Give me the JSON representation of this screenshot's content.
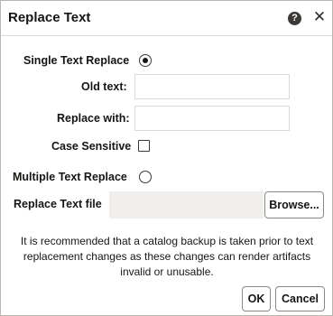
{
  "dialog": {
    "title": "Replace Text",
    "help_symbol": "?",
    "close_symbol": "✕"
  },
  "form": {
    "single_replace_label": "Single Text Replace",
    "single_replace_selected": true,
    "old_text_label": "Old text:",
    "old_text_value": "",
    "replace_with_label": "Replace with:",
    "replace_with_value": "",
    "case_sensitive_label": "Case Sensitive",
    "case_sensitive_checked": false,
    "multiple_replace_label": "Multiple Text Replace",
    "multiple_replace_selected": false,
    "replace_file_label": "Replace Text file",
    "browse_label": "Browse..."
  },
  "notice": "It is recommended that a catalog backup is taken prior to text replacement changes as these changes can render artifacts invalid or unusable.",
  "footer": {
    "ok_label": "OK",
    "cancel_label": "Cancel"
  }
}
